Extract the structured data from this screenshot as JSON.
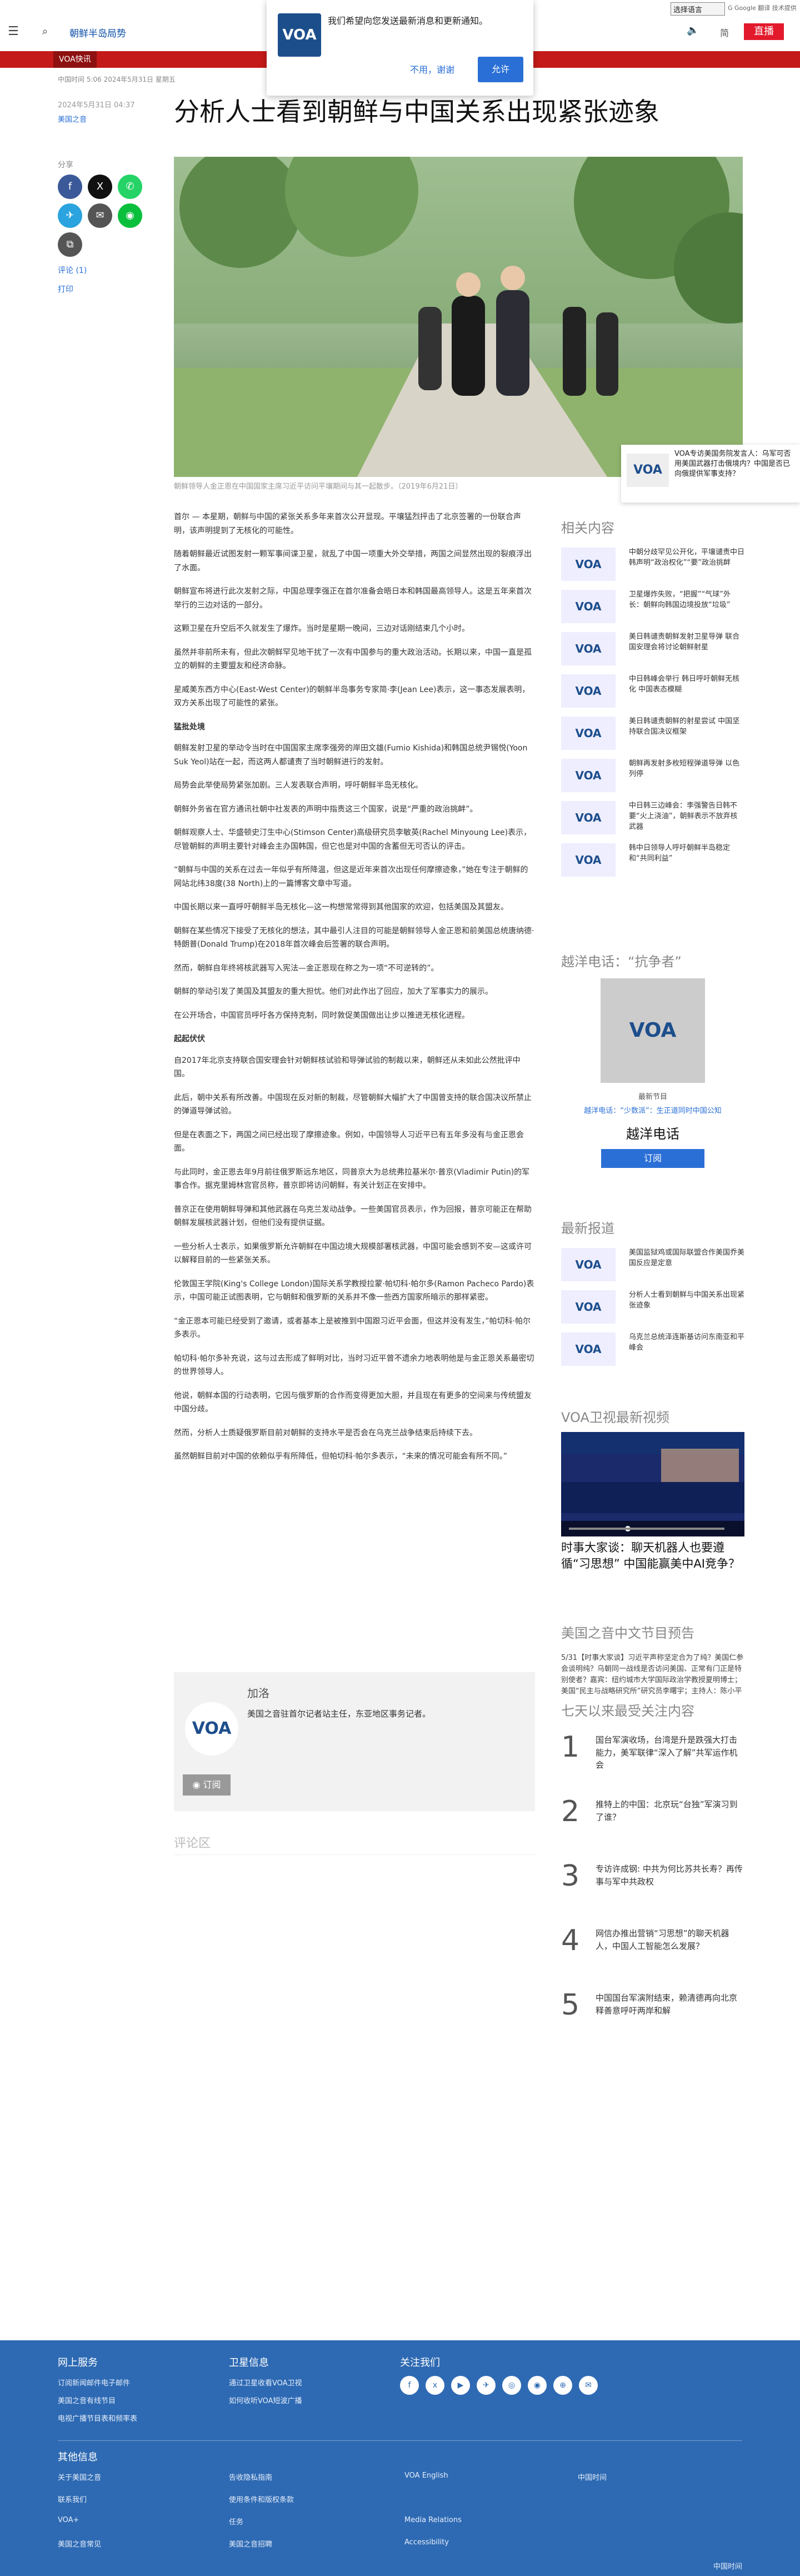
{
  "header": {
    "topic": "朝鲜半岛局势",
    "lang_select": "选择语言",
    "gtranslate": "G Google 翻译 技术提供",
    "lang_label": "简",
    "live": "直播",
    "ticker_tag": "VOA快讯"
  },
  "notification": {
    "text": "我们希望向您发送最新消息和更新通知。",
    "deny": "不用，谢谢",
    "allow": "允许"
  },
  "article": {
    "meta": "中国时间 5:06 2024年5月31日 星期五",
    "date": "2024年5月31日 04:37",
    "add_label": "美国之音",
    "title": "分析人士看到朝鲜与中国关系出现紧张迹象",
    "share_label": "分享",
    "comments": "评论 (1)",
    "print": "打印",
    "caption": "朝鲜领导人金正恩在中国国家主席习近平访问平壤期间与其一起散步。（2019年6月21日）",
    "paragraphs": [
      "首尔 — 本星期，朝鲜与中国的紧张关系多年来首次公开显现。平壤猛烈抨击了北京签署的一份联合声明，该声明提到了无核化的可能性。",
      "随着朝鲜最近试图发射一颗军事间谍卫星，就乱了中国一项重大外交举措，两国之间显然出现的裂痕浮出了水面。",
      "朝鲜宣布将进行此次发射之际，中国总理李强正在首尔准备会晤日本和韩国最高领导人。这是五年来首次举行的三边对话的一部分。",
      "这颗卫星在升空后不久就发生了爆炸。当时是星期一晚间，三边对话刚结束几个小时。",
      "虽然并非前所未有，但此次朝鲜罕见地干扰了一次有中国参与的重大政治活动。长期以来，中国一直是孤立的朝鲜的主要盟友和经济命脉。",
      "星威美东西方中心(East-West Center)的朝鲜半岛事务专家简·李(Jean Lee)表示，这一事态发展表明，双方关系出现了可能性的紧张。"
    ],
    "h_reaction": "猛批处境",
    "paragraphs2": [
      "朝鲜发射卫星的举动令当时在中国国家主席李强旁的岸田文雄(Fumio Kishida)和韩国总统尹锡悦(Yoon Suk Yeol)站在一起，而这两人都谴责了当时朝鲜进行的发射。",
      "局势会此举使局势紧张加剧。三人发表联合声明，呼吁朝鲜半岛无核化。",
      "朝鲜外务省在官方通讯社朝中社发表的声明中指责这三个国家，说是“严重的政治挑衅”。",
      "朝鲜观察人士、华盛顿史汀生中心(Stimson Center)高级研究员李敏英(Rachel Minyoung Lee)表示，尽管朝鲜的声明主要针对峰会主办国韩国，但它也是对中国的含蓄但无可否认的评击。",
      "“朝鲜与中国的关系在过去一年似乎有所降温，但这是近年来首次出现任何摩擦迹象，”她在专注于朝鲜的网站北纬38度(38 North)上的一篇博客文章中写道。",
      "中国长期以来一直呼吁朝鲜半岛无核化—这一构想常常得到其他国家的欢迎，包括美国及其盟友。",
      "朝鲜在某些情况下接受了无核化的想法，其中最引人注目的可能是朝鲜领导人金正恩和前美国总统唐纳德·特朗普(Donald Trump)在2018年首次峰会后签署的联合声明。",
      "然而，朝鲜自年终将核武器写入宪法—金正恩现在称之为一项“不可逆转的”。",
      "朝鲜的举动引发了美国及其盟友的重大担忧。他们对此作出了回应，加大了军事实力的展示。",
      "在公开场合，中国官员呼吁各方保持克制，同时敦促美国做出让步以推进无核化进程。"
    ],
    "h_crack": "起起伏伏",
    "paragraphs3": [
      "自2017年北京支持联合国安理会针对朝鲜核试验和导弹试验的制裁以来，朝鲜还从未如此公然批评中国。",
      "此后，朝中关系有所改善。中国现在反对新的制裁，尽管朝鲜大幅扩大了中国曾支持的联合国决议所禁止的弹道导弹试验。",
      "但是在表面之下，两国之间已经出现了摩擦迹象。例如，中国领导人习近平已有五年多没有与金正恩会面。",
      "与此同时，金正恩去年9月前往俄罗斯远东地区，同普京大为总统弗拉基米尔·普京(Vladimir Putin)的军事合作。据克里姆林宫官员称，普京即将访问朝鲜，有关计划正在安排中。",
      "普京正在使用朝鲜导弹和其他武器在乌克兰发动战争。一些美国官员表示，作为回报，普京可能正在帮助朝鲜发展核武器计划，但他们没有提供证据。",
      "一些分析人士表示，如果俄罗斯允许朝鲜在中国边境大规模部署核武器，中国可能会感到不安—这或许可以解释目前的一些紧张关系。",
      "伦敦国王学院(King's College London)国际关系学教授拉蒙·帕切科·帕尔多(Ramon Pacheco Pardo)表示，中国可能正试图表明，它与朝鲜和俄罗斯的关系并不像一些西方国家所暗示的那样紧密。",
      "“金正恩本可能已经受到了邀请，或者基本上是被推到中国跟习近平会面，但这并没有发生，”帕切科·帕尔多表示。",
      "帕切科·帕尔多补充说，这与过去形成了鲜明对比，当时习近平曾不遗余力地表明他是与金正恩关系最密切的世界领导人。",
      "他说，朝鲜本国的行动表明，它因与俄罗斯的合作而变得更加大胆，并且现在有更多的空间来与传统盟友中国分歧。",
      "然而，分析人士质疑俄罗斯目前对朝鲜的支持水平是否会在乌克兰战争结束后持续下去。",
      "虽然朝鲜目前对中国的依赖似乎有所降低，但帕切科·帕尔多表示，“未来的情况可能会有所不同。”"
    ]
  },
  "floatcard": {
    "logo": "VOA",
    "text": "VOA专访美国务院发言人：乌军可否用美国武器打击俄境内？中国是否已向俄提供军事支持？"
  },
  "author": {
    "label": "加洛",
    "logo": "VOA",
    "desc": "美国之音驻首尔记者站主任，东亚地区事务记者。",
    "subscribe": "订阅"
  },
  "comment_zone": "评论区",
  "sidebar": {
    "related_title": "相关内容",
    "related": [
      {
        "logo": "VOA",
        "text": "中朝分歧罕见公开化，平壤谴责中日韩声明“政治权化”“要”政治挑衅"
      },
      {
        "logo": "VOA",
        "text": "卫星爆炸失败，“把握”“气球”外长：朝鲜向韩国边境投放“垃圾”"
      },
      {
        "logo": "VOA",
        "text": "美日韩谴责朝鲜发射卫星导弹 联合国安理会将讨论朝鲜射星"
      },
      {
        "logo": "VOA",
        "text": "中日韩峰会举行 韩日呼吁朝鲜无核化 中国表态模糊"
      },
      {
        "logo": "VOA",
        "text": "美日韩谴责朝鲜的射星尝试 中国坚持联合国决议框架"
      },
      {
        "logo": "VOA",
        "text": "朝鲜再发射多枚短程弹道导弹 以色列停"
      },
      {
        "logo": "VOA",
        "text": "中日韩三边峰会：李强警告日韩不要“火上浇油”，朝鲜表示不放弃核武器"
      },
      {
        "logo": "VOA",
        "text": "韩中日领导人呼吁朝鲜半岛稳定和“共同利益”"
      }
    ],
    "podcast_title": "越洋电话：“抗争者”",
    "podcast_cover": "VOA",
    "podcast_latest": "最新节目",
    "podcast_episode": "越洋电话：“少数派”：生正道同时中国公知",
    "podcast_name": "越洋电话",
    "podcast_sub": "订阅",
    "latest_title": "最新报道",
    "latest": [
      {
        "logo": "VOA",
        "text": "美国监狱鸡或国际联盟合作美国乔美国反应是定意"
      },
      {
        "logo": "VOA",
        "text": "分析人士看到朝鲜与中国关系出现紧张迹象"
      },
      {
        "logo": "VOA",
        "text": "乌克兰总统泽连斯基访问东南亚和平峰会"
      }
    ],
    "video_title": "VOA卫视最新视频",
    "video_caption": "时事大家谈：聊天机器人也要遵循“习思想” 中国能赢美中AI竞争？",
    "program_title": "美国之音中文节目预告",
    "program_text": "5/31【时事大家谈】习近平声称坚定合为了纯？美国仁参会谈明纯？乌朝同一战线是否访问美国、正常有门正是特别使者？嘉宾：纽约城市大学国际政治学教授夏明博士；美国“民主与战略研究所”研究员李曙宇；主持人：陈小平",
    "top7_title": "七天以来最受关注内容",
    "top7": [
      {
        "n": "1",
        "text": "国台军演收场，台湾是升是跌强大打击能力，美军联律“深入了解”共军运作机会"
      },
      {
        "n": "2",
        "text": "推特上的中国：北京玩“台独”军演习到了谁？"
      },
      {
        "n": "3",
        "text": "专访许成钢: 中共为何比苏共长寿？再传事与军中共政权"
      },
      {
        "n": "4",
        "text": "网信办推出营销“习思想”的聊天机器人，中国人工智能怎么发展？"
      },
      {
        "n": "5",
        "text": "中国国台军演附结束，赖清德再向北京释善意呼吁两岸和解"
      }
    ]
  },
  "footer": {
    "col1_title": "网上服务",
    "col1": [
      "订阅新闻邮件电子邮件",
      "美国之音有线节目",
      "电视广播节目表和频率表"
    ],
    "col2_title": "卫星信息",
    "col2": [
      "通过卫星收看VOA卫视",
      "如何收听VOA短波广播"
    ],
    "col3_title": "关注我们",
    "social": [
      "f",
      "x",
      "▶",
      "✈",
      "◎",
      "◉",
      "⊕",
      "✉"
    ],
    "other_title": "其他信息",
    "other": [
      "关于美国之音",
      "联系我们",
      "VOA+",
      "美国之音常见",
      "告收隐私指南",
      "使用条件和版权条款",
      "任务",
      "美国之音招聘",
      "VOA English",
      "",
      "Media Relations",
      "Accessibility",
      "中国时间"
    ],
    "bottom_right": "中国时间"
  }
}
